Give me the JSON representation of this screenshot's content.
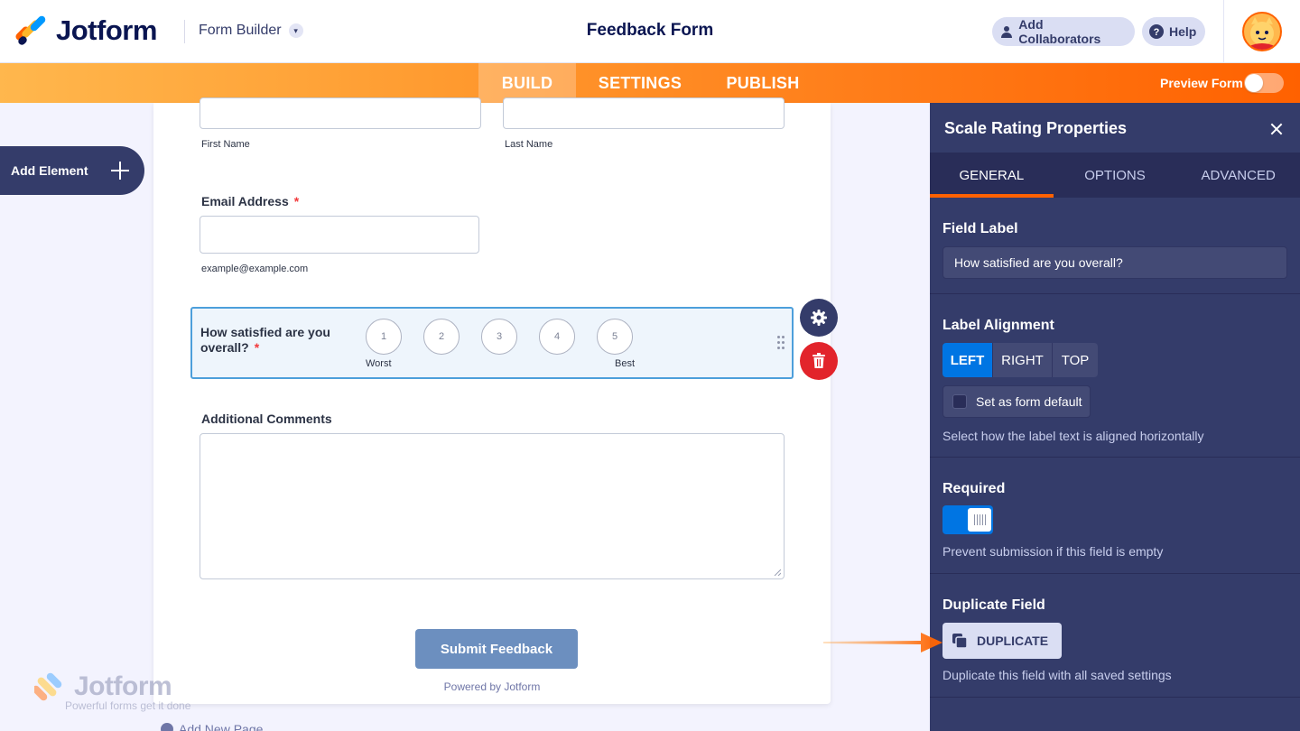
{
  "header": {
    "logo_text": "Jotform",
    "builder_label": "Form Builder",
    "form_title": "Feedback Form",
    "collab_label": "Add Collaborators",
    "help_label": "Help"
  },
  "nav": {
    "tabs": [
      "BUILD",
      "SETTINGS",
      "PUBLISH"
    ],
    "active_tab": "BUILD",
    "preview_label": "Preview Form",
    "preview_on": false
  },
  "left": {
    "add_element_label": "Add Element"
  },
  "form": {
    "first_name_sublabel": "First Name",
    "last_name_sublabel": "Last Name",
    "email_label": "Email Address",
    "email_required_mark": "*",
    "email_sublabel": "example@example.com",
    "scale_label": "How satisfied are you overall?",
    "scale_required_mark": "*",
    "scale_options": [
      "1",
      "2",
      "3",
      "4",
      "5"
    ],
    "scale_worst": "Worst",
    "scale_best": "Best",
    "comments_label": "Additional Comments",
    "submit_label": "Submit Feedback",
    "powered_by": "Powered by Jotform",
    "add_page_label": "Add New Page"
  },
  "watermark": {
    "brand": "Jotform",
    "tagline": "Powerful forms get it done"
  },
  "panel": {
    "title": "Scale Rating Properties",
    "tabs": [
      "GENERAL",
      "OPTIONS",
      "ADVANCED"
    ],
    "active_tab": "GENERAL",
    "field_label_title": "Field Label",
    "field_label_value": "How satisfied are you overall?",
    "alignment_title": "Label Alignment",
    "alignment_options": [
      "LEFT",
      "RIGHT",
      "TOP"
    ],
    "alignment_selected": "LEFT",
    "set_default_label": "Set as form default",
    "alignment_hint": "Select how the label text is aligned horizontally",
    "required_title": "Required",
    "required_on": true,
    "required_hint": "Prevent submission if this field is empty",
    "duplicate_title": "Duplicate Field",
    "duplicate_button": "DUPLICATE",
    "duplicate_hint": "Duplicate this field with all saved settings"
  },
  "colors": {
    "brand_orange": "#ff6100",
    "navy": "#0a1551",
    "panel_bg": "#343c6a",
    "selected_blue": "#0075e3",
    "delete_red": "#e2242b"
  }
}
